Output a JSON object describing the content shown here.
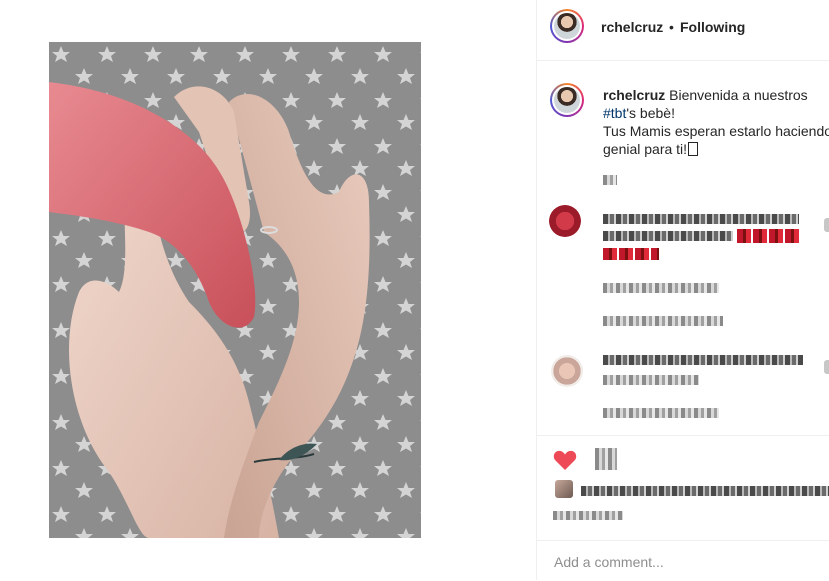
{
  "post": {
    "username": "rchelcruz",
    "follow_separator": "•",
    "follow_state": "Following",
    "caption_prefix": "Bienvenida a nuestros",
    "hashtag": "#tbt",
    "caption_suffix": "'s bebè!",
    "caption_line2": "Tus Mamis esperan estarlo haciendo",
    "caption_line3": "genial para ti!",
    "caption_emoji": "",
    "add_comment_placeholder": "Add a comment...",
    "liked": true,
    "colors": {
      "accent_heart": "#ed4956",
      "hashtag": "#00376b",
      "username": "#262626"
    },
    "icons": [
      "heart-icon",
      "avatar"
    ]
  }
}
